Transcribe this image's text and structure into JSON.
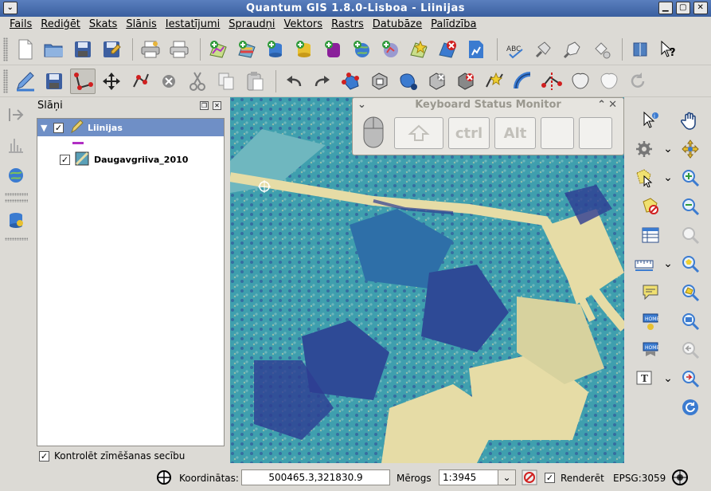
{
  "window": {
    "title": "Quantum GIS 1.8.0-Lisboa - Liinijas"
  },
  "menu": [
    {
      "label": "Fails"
    },
    {
      "label": "Rediģēt"
    },
    {
      "label": "Skats"
    },
    {
      "label": "Slānis"
    },
    {
      "label": "Iestatījumi"
    },
    {
      "label": "Spraudņi"
    },
    {
      "label": "Vektors"
    },
    {
      "label": "Rastrs"
    },
    {
      "label": "Datubāze"
    },
    {
      "label": "Palīdzība"
    }
  ],
  "layers_panel": {
    "title": "Slāņi",
    "layers": [
      {
        "name": "Liinijas",
        "checked": "✓",
        "selected": true
      },
      {
        "name": "Daugavgriiva_2010",
        "checked": "✓",
        "selected": false
      }
    ],
    "render_order_label": "Kontrolēt zīmēšanas secību",
    "render_order_checked": "✓"
  },
  "keyboard_monitor": {
    "title": "Keyboard Status Monitor",
    "keys": [
      "ctrl",
      "Alt"
    ]
  },
  "statusbar": {
    "coord_label": "Koordinātas:",
    "coord_value": "500465.3,321830.9",
    "scale_label": "Mērogs",
    "scale_value": "1:3945",
    "render_label": "Renderēt",
    "render_checked": "✓",
    "crs": "EPSG:3059"
  },
  "colors": {
    "title_bar": "#3a5f9f",
    "selected_layer": "#6f8fc6",
    "line_symbol": "#b12fc4",
    "map_teal": "#3f9fae",
    "map_sand": "#e6dca6",
    "map_dark": "#2e3c92"
  }
}
